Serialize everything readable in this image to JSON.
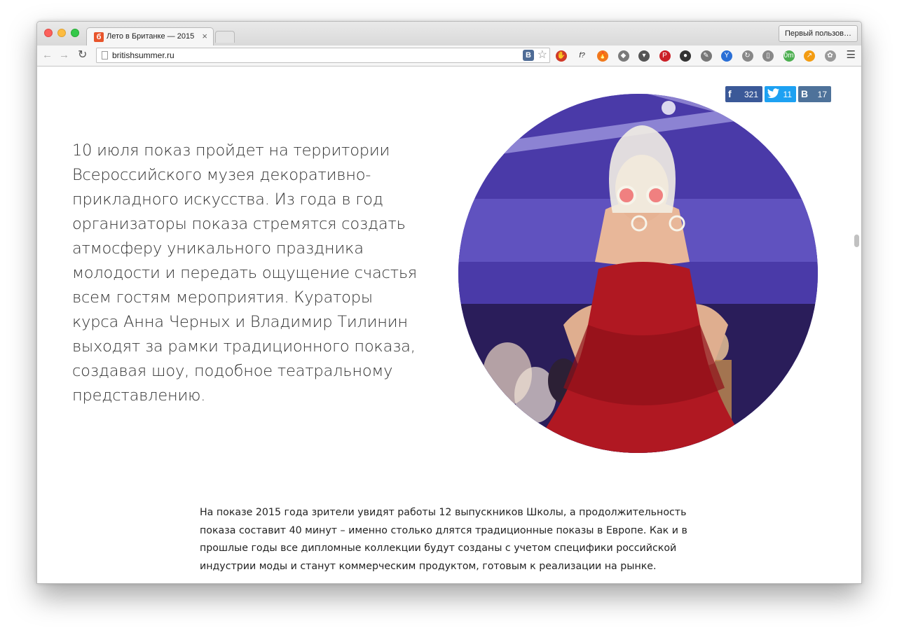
{
  "browser": {
    "tab_title": "Лето в Британке — 2015",
    "tab_favicon_text": "б",
    "tab_close": "×",
    "user_button": "Первый пользов…",
    "url": "britishsummer.ru",
    "vk_extension_letter": "B",
    "icons": [
      "back-arrow-icon",
      "forward-arrow-icon",
      "reload-icon",
      "page-icon",
      "vk-icon",
      "star-icon",
      "menu-icon"
    ]
  },
  "extensions": [
    {
      "name": "adblock-icon",
      "color": "#d03a2a",
      "glyph": "✋"
    },
    {
      "name": "fquery-icon",
      "color": "#ffffff",
      "glyph": "f?"
    },
    {
      "name": "fire-icon",
      "color": "#f07a1e",
      "glyph": "🔥"
    },
    {
      "name": "evernote-icon",
      "color": "#7a7a7a",
      "glyph": "◆"
    },
    {
      "name": "pocket-icon",
      "color": "#555555",
      "glyph": "▾"
    },
    {
      "name": "pinterest-icon",
      "color": "#cb2027",
      "glyph": "P"
    },
    {
      "name": "circle-icon",
      "color": "#333333",
      "glyph": "●"
    },
    {
      "name": "eyedropper-icon",
      "color": "#777777",
      "glyph": "✎"
    },
    {
      "name": "y-icon",
      "color": "#2a6fd6",
      "glyph": "Y"
    },
    {
      "name": "refresh-ext-icon",
      "color": "#888888",
      "glyph": "↻"
    },
    {
      "name": "reader-icon",
      "color": "#888888",
      "glyph": "▯"
    },
    {
      "name": "time-icon",
      "color": "#4caf50",
      "glyph": "0m"
    },
    {
      "name": "chart-icon",
      "color": "#f39c12",
      "glyph": "↗"
    },
    {
      "name": "paw-icon",
      "color": "#999999",
      "glyph": "✿"
    }
  ],
  "share": {
    "facebook": {
      "icon": "f",
      "count": "321"
    },
    "twitter": {
      "icon": "t",
      "count": "11"
    },
    "vk": {
      "icon": "B",
      "count": "17"
    }
  },
  "content": {
    "lead_paragraph": "10 июля показ пройдет на территории Всероссийского музея декоративно-прикладного искусства. Из года в год организаторы показа стремятся создать атмосферу уникального праздника молодости и передать ощущение счастья всем гостям мероприятия. Кураторы курса Анна Черных и Владимир Тилинин выходят за рамки традиционного показа, создавая шоу, подобное театральному представлению.",
    "body_paragraph": "На показе 2015 года зрители увидят работы 12 выпускников Школы, а продолжительность показа составит 40 минут – именно столько длятся традиционные показы в Европе. Как и в прошлые годы все дипломные коллекции будут созданы с учетом специфики российской индустрии моды и станут коммерческим продуктом, готовым к реализации на рынке.",
    "photo": "runway-model-red-dress-photo"
  },
  "colors": {
    "facebook": "#3b5998",
    "twitter": "#1da1f2",
    "vk": "#4e729a",
    "text": "#333333"
  }
}
